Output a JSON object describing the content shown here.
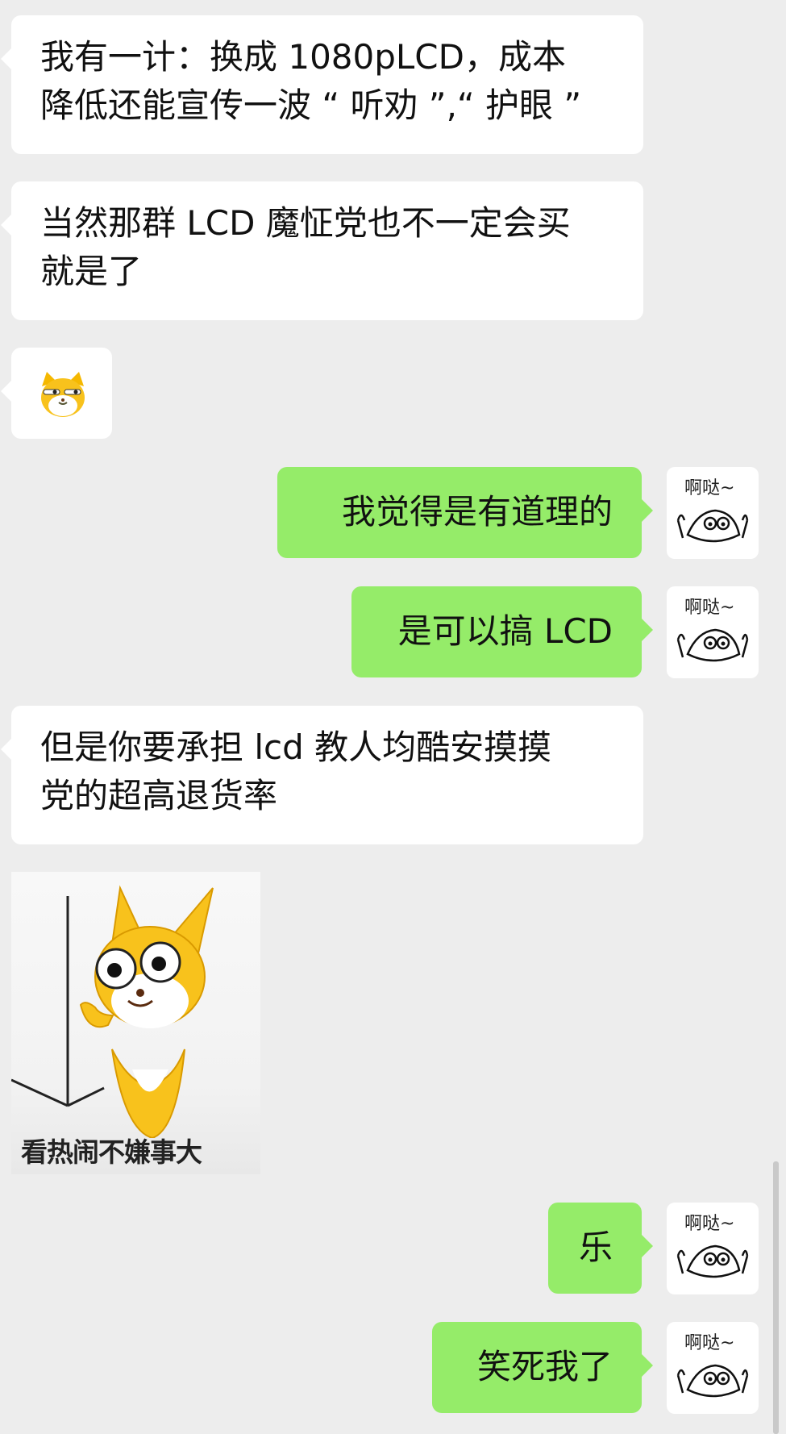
{
  "messages": [
    {
      "side": "left",
      "text_lines": [
        "我有一计：换成 1080pLCD，成本",
        "降低还能宣传一波 “ 听劝 ”,“ 护眼 ”"
      ]
    },
    {
      "side": "left",
      "text_lines": [
        "当然那群 LCD 魔怔党也不一定会买",
        "就是了"
      ]
    },
    {
      "side": "left",
      "sticker": "cat-face-emoji"
    },
    {
      "side": "right",
      "text": "我觉得是有道理的"
    },
    {
      "side": "right",
      "text": "是可以搞 LCD"
    },
    {
      "side": "left",
      "text_lines": [
        "但是你要承担 lcd 教人均酷安摸摸",
        "党的超高退货率"
      ]
    },
    {
      "side": "left",
      "sticker": "cat-peeking-sticker",
      "caption": "看热闹不嫌事大"
    },
    {
      "side": "right",
      "text": "乐"
    },
    {
      "side": "right",
      "text": "笑死我了"
    }
  ],
  "avatar": {
    "label": "啊哒~",
    "icon": "doodle-avatar-icon"
  },
  "colors": {
    "background": "#ededed",
    "incoming_bubble": "#ffffff",
    "outgoing_bubble": "#95ec69"
  }
}
